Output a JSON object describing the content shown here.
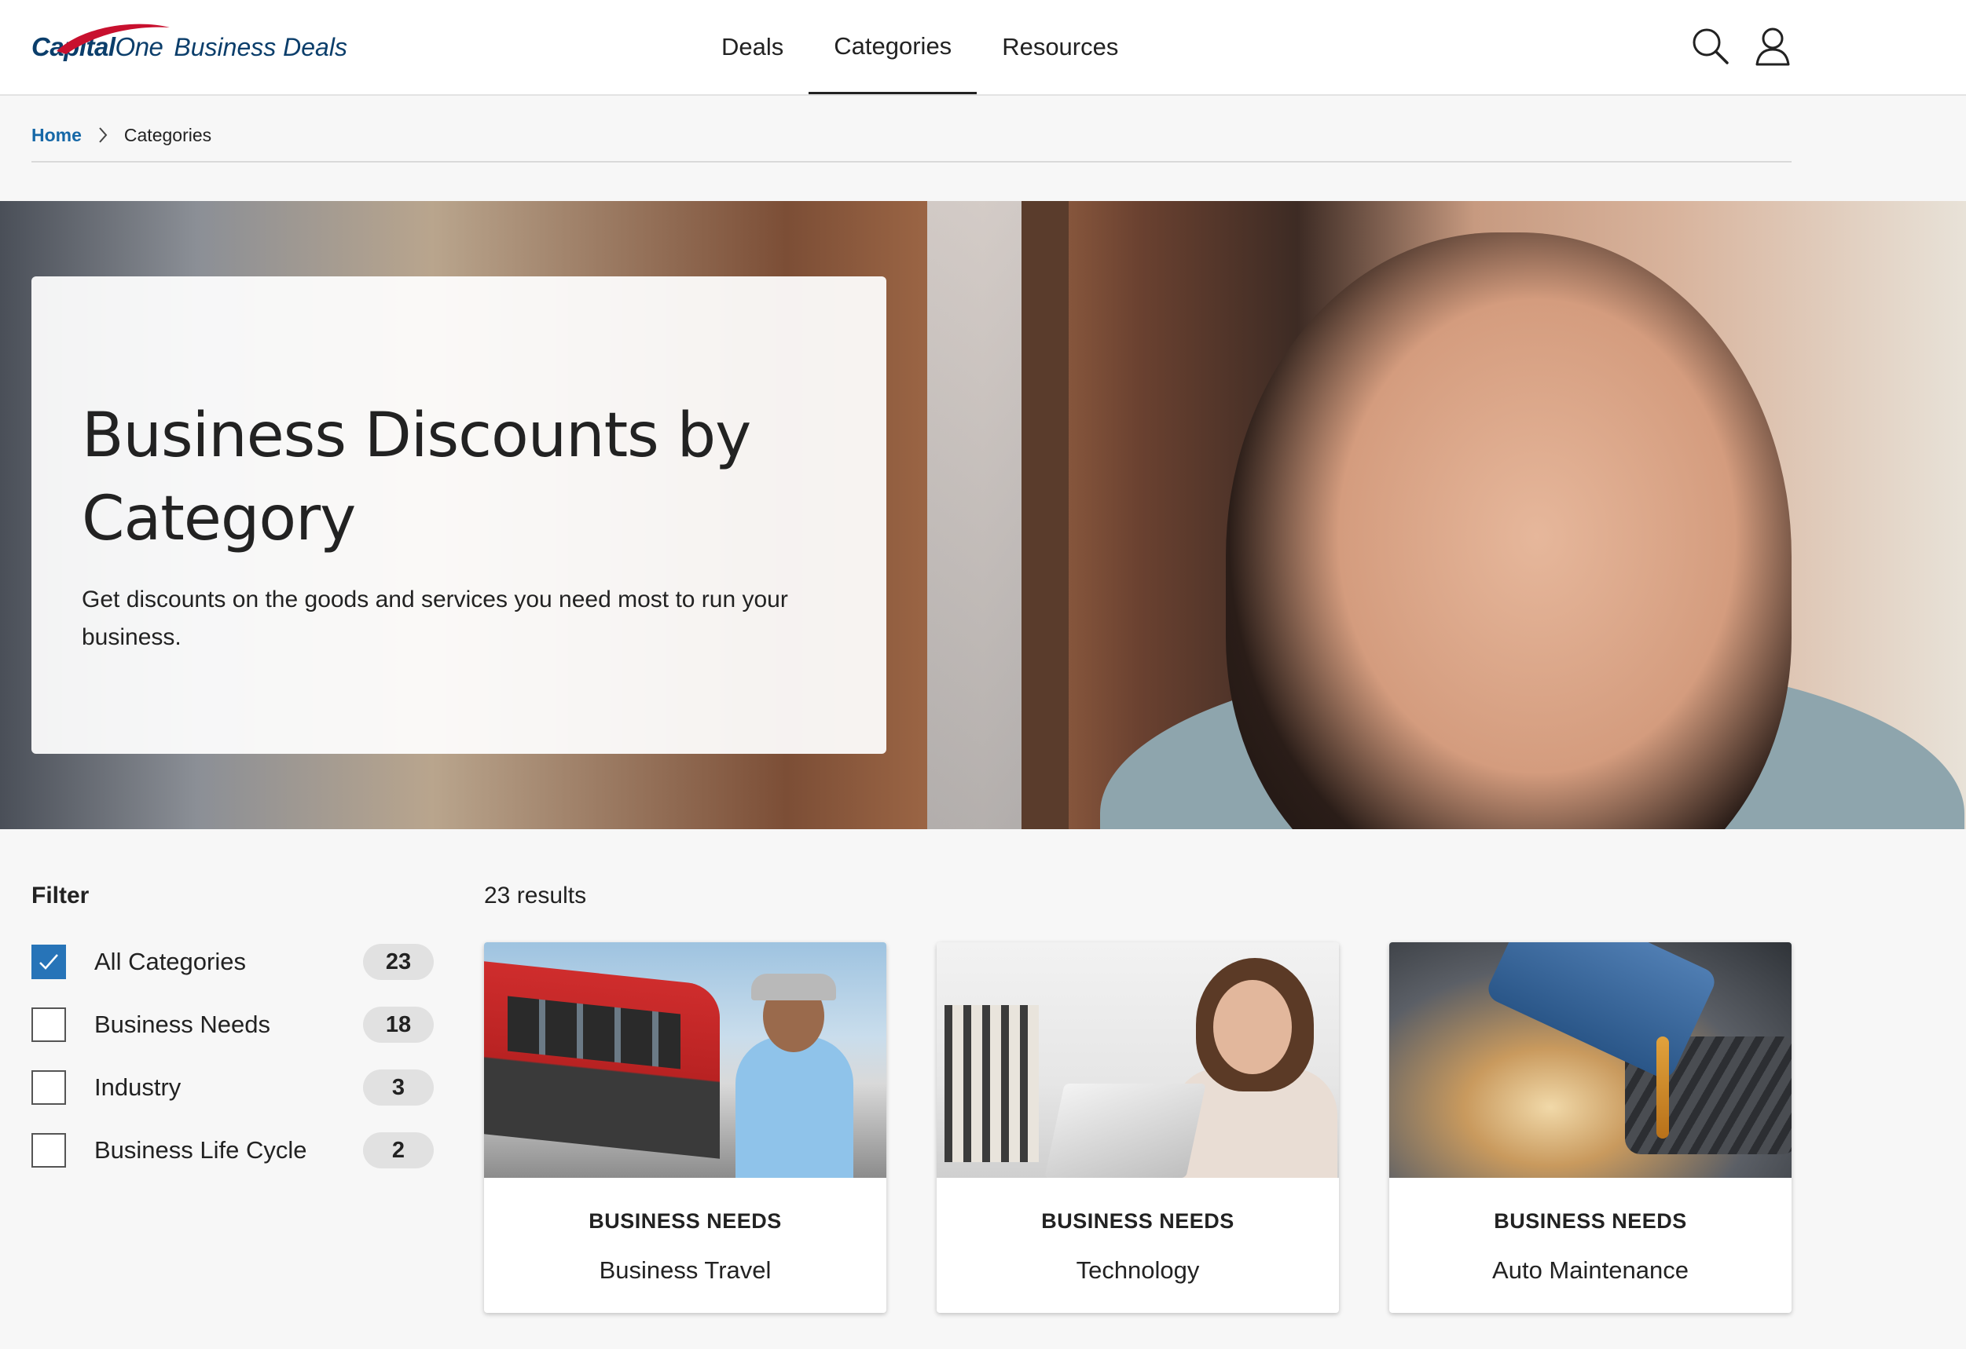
{
  "header": {
    "logo_brand": "Capital",
    "logo_brand_one": "One",
    "logo_product": "Business Deals",
    "nav": [
      {
        "label": "Deals",
        "active": false
      },
      {
        "label": "Categories",
        "active": true
      },
      {
        "label": "Resources",
        "active": false
      }
    ],
    "icons": [
      "search-icon",
      "user-icon"
    ]
  },
  "breadcrumb": {
    "home": "Home",
    "current": "Categories"
  },
  "hero": {
    "title": "Business Discounts by Category",
    "subtitle": "Get discounts on the goods and services you need most to run your business."
  },
  "filter": {
    "title": "Filter",
    "options": [
      {
        "label": "All Categories",
        "count": "23",
        "checked": true
      },
      {
        "label": "Business Needs",
        "count": "18",
        "checked": false
      },
      {
        "label": "Industry",
        "count": "3",
        "checked": false
      },
      {
        "label": "Business Life Cycle",
        "count": "2",
        "checked": false
      }
    ]
  },
  "results": {
    "count_text": "23 results",
    "cards": [
      {
        "category": "BUSINESS NEEDS",
        "name": "Business Travel"
      },
      {
        "category": "BUSINESS NEEDS",
        "name": "Technology"
      },
      {
        "category": "BUSINESS NEEDS",
        "name": "Auto Maintenance"
      }
    ]
  },
  "colors": {
    "brand_navy": "#0b3e6b",
    "brand_red": "#c8102e",
    "link_blue": "#1668a7",
    "checkbox_blue": "#2774b8"
  }
}
